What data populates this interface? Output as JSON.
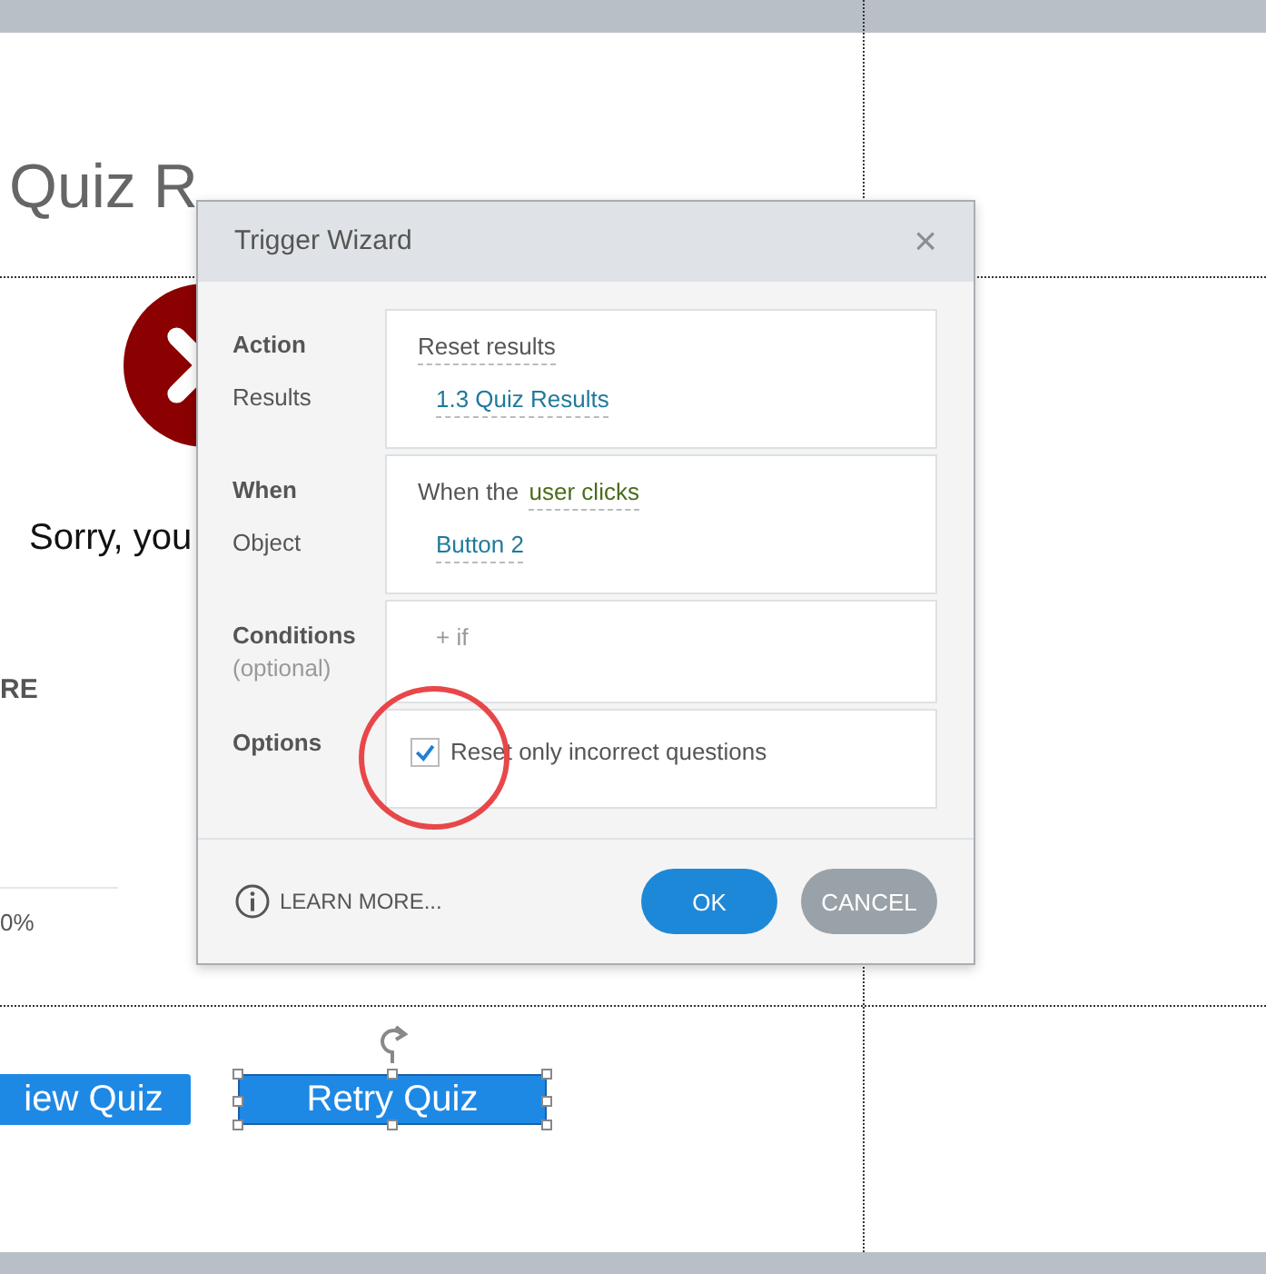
{
  "slide": {
    "title": "Quiz R",
    "feedback": "Sorry, you",
    "score_label": "RE",
    "percent": "0%",
    "buttons": [
      {
        "label": "iew Quiz",
        "selected": false
      },
      {
        "label": "Retry Quiz",
        "selected": true
      }
    ]
  },
  "dialog": {
    "title": "Trigger Wizard",
    "close": "×",
    "rows": [
      {
        "kind": "action",
        "label": "Action",
        "sub_label": "Results",
        "value": "Reset results",
        "target": "1.3 Quiz Results"
      },
      {
        "kind": "event",
        "label": "When",
        "sub_label": "Object",
        "prefix": "When the",
        "value": "user clicks",
        "target": "Button 2"
      },
      {
        "kind": "conditions",
        "label": "Conditions",
        "sub_label": "(optional)",
        "add": "+ if"
      },
      {
        "kind": "option",
        "label": "Options",
        "option": {
          "label": "Reset only incorrect questions",
          "checked": true
        }
      }
    ],
    "learn_more": "LEARN MORE...",
    "ok": "OK",
    "cancel": "CANCEL"
  }
}
